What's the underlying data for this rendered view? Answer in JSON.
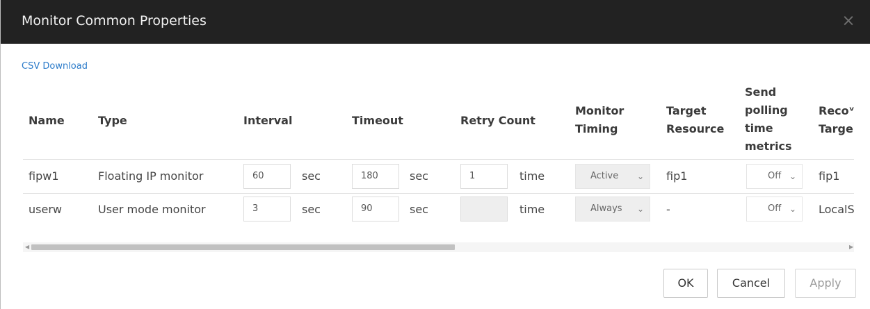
{
  "dialog": {
    "title": "Monitor Common Properties",
    "close_icon": "×",
    "csv_link": "CSV Download"
  },
  "table": {
    "headers": {
      "name": "Name",
      "type": "Type",
      "interval": "Interval",
      "timeout": "Timeout",
      "retry_count": "Retry Count",
      "monitor_timing": [
        "Monitor",
        "Timing"
      ],
      "target_resource": [
        "Target",
        "Resource"
      ],
      "send_polling": [
        "Send",
        "polling",
        "time",
        "metrics"
      ],
      "recovery_target": [
        "Recoᵛ",
        "Targe"
      ]
    },
    "rows": [
      {
        "name": "fipw1",
        "type": "Floating IP monitor",
        "interval": "60",
        "interval_unit": "sec",
        "timeout": "180",
        "timeout_unit": "sec",
        "retry_count": "1",
        "retry_unit": "time",
        "monitor_timing": "Active",
        "target_resource": "fip1",
        "send_polling": "Off",
        "recovery_target": "fip1"
      },
      {
        "name": "userw",
        "type": "User mode monitor",
        "interval": "3",
        "interval_unit": "sec",
        "timeout": "90",
        "timeout_unit": "sec",
        "retry_count": "",
        "retry_unit": "time",
        "monitor_timing": "Always",
        "target_resource": "-",
        "send_polling": "Off",
        "recovery_target": "LocalS"
      }
    ]
  },
  "buttons": {
    "ok": "OK",
    "cancel": "Cancel",
    "apply": "Apply"
  },
  "colors": {
    "title_bar": "#222222",
    "link": "#2a7ac9"
  }
}
